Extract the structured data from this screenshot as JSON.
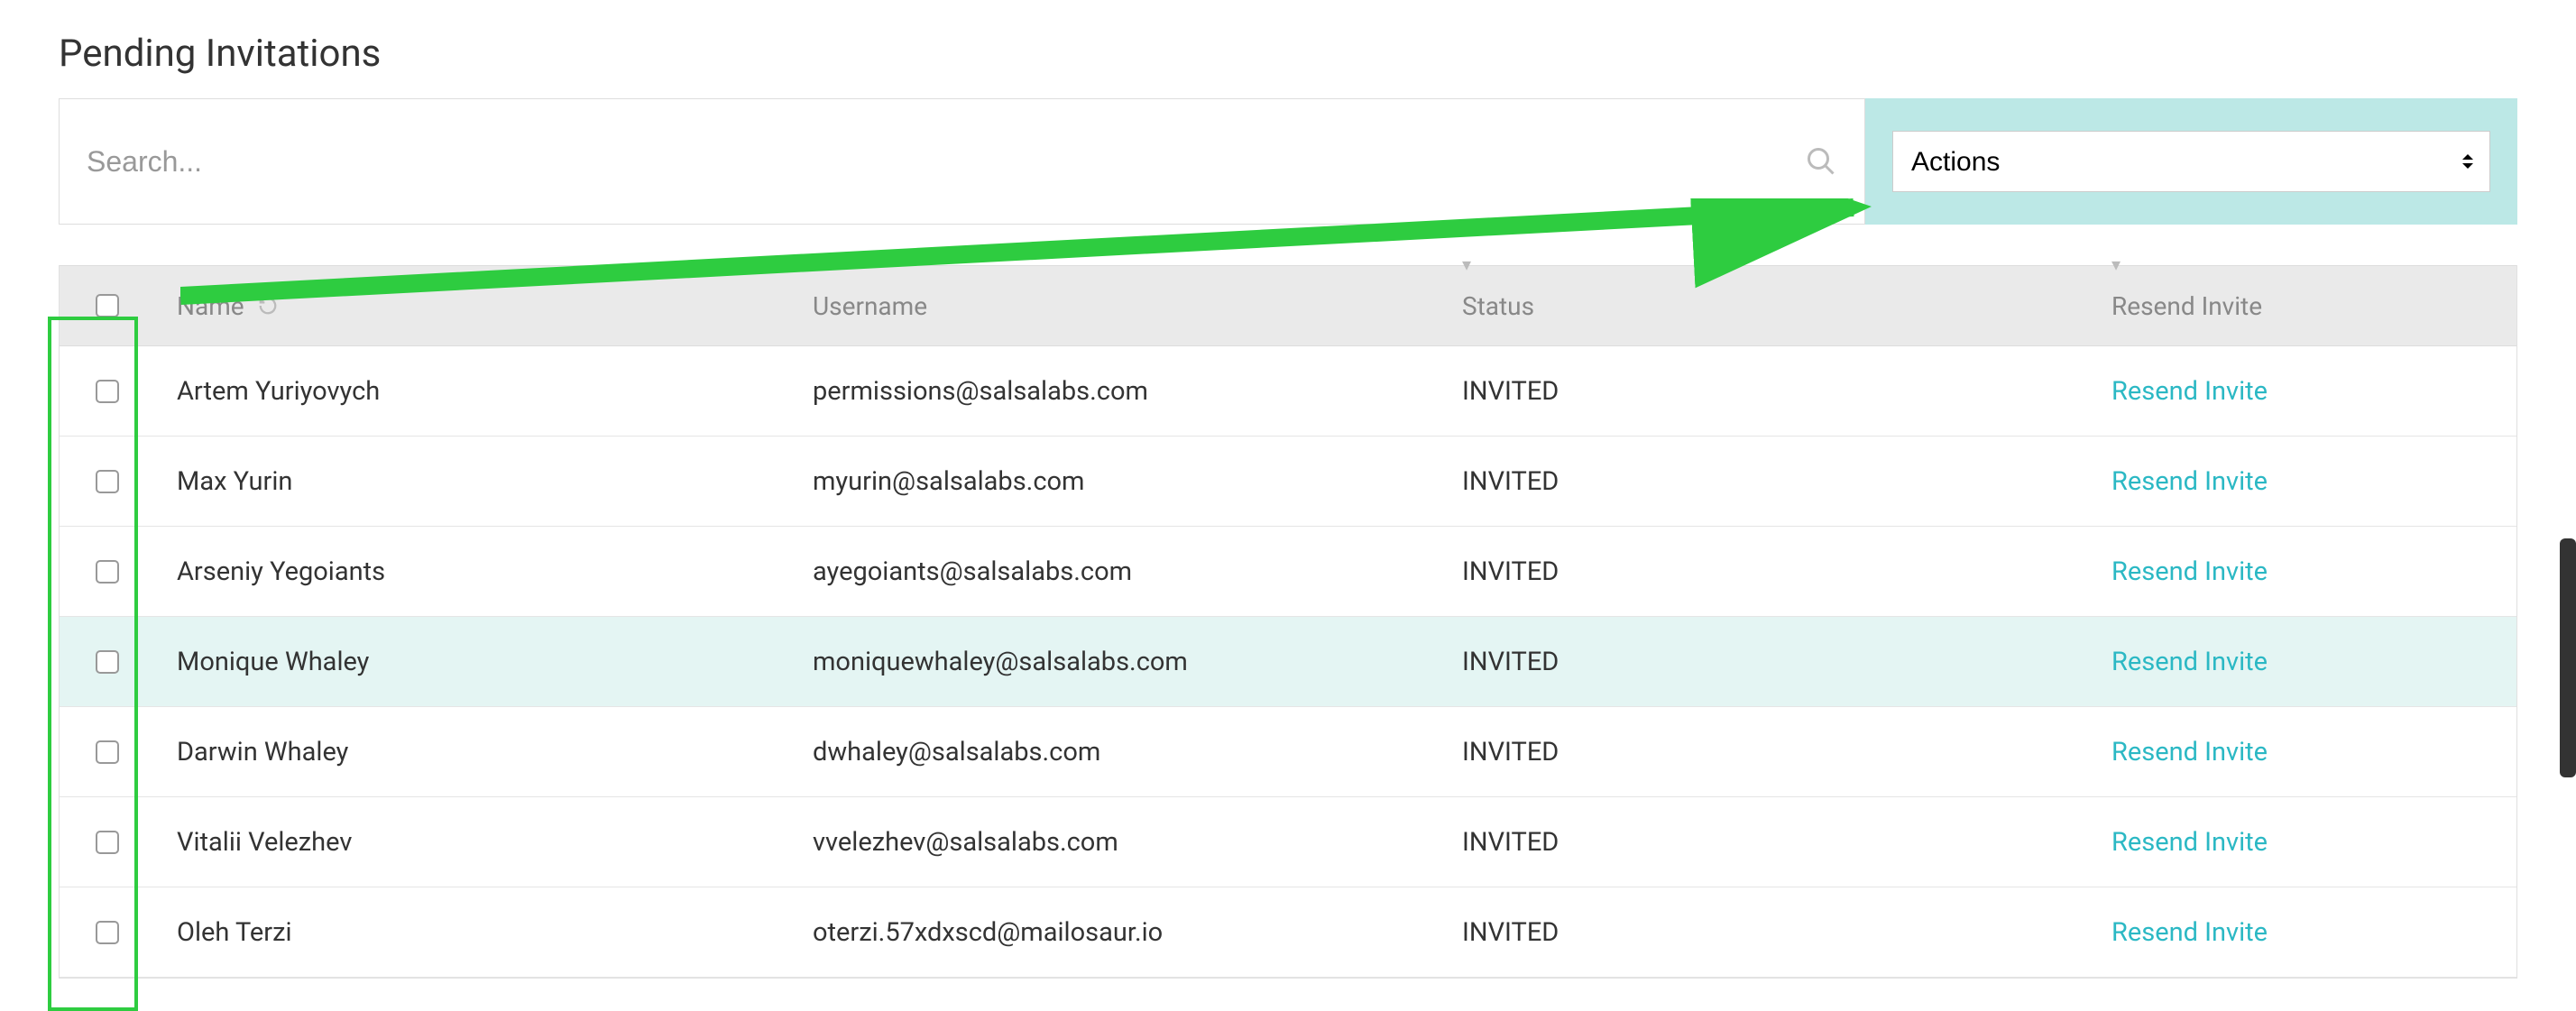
{
  "page": {
    "title": "Pending Invitations"
  },
  "search": {
    "placeholder": "Search..."
  },
  "actions": {
    "label": "Actions"
  },
  "table": {
    "headers": {
      "name": "Name",
      "username": "Username",
      "status": "Status",
      "resend": "Resend Invite"
    },
    "rows": [
      {
        "name": "Artem Yuriyovych",
        "username": "permissions@salsalabs.com",
        "status": "INVITED",
        "resend": "Resend Invite",
        "highlighted": false
      },
      {
        "name": "Max Yurin",
        "username": "myurin@salsalabs.com",
        "status": "INVITED",
        "resend": "Resend Invite",
        "highlighted": false
      },
      {
        "name": "Arseniy Yegoiants",
        "username": "ayegoiants@salsalabs.com",
        "status": "INVITED",
        "resend": "Resend Invite",
        "highlighted": false
      },
      {
        "name": "Monique Whaley",
        "username": "moniquewhaley@salsalabs.com",
        "status": "INVITED",
        "resend": "Resend Invite",
        "highlighted": true
      },
      {
        "name": "Darwin Whaley",
        "username": "dwhaley@salsalabs.com",
        "status": "INVITED",
        "resend": "Resend Invite",
        "highlighted": false
      },
      {
        "name": "Vitalii Velezhev",
        "username": "vvelezhev@salsalabs.com",
        "status": "INVITED",
        "resend": "Resend Invite",
        "highlighted": false
      },
      {
        "name": "Oleh Terzi",
        "username": "oterzi.57xdxscd@mailosaur.io",
        "status": "INVITED",
        "resend": "Resend Invite",
        "highlighted": false
      }
    ]
  }
}
